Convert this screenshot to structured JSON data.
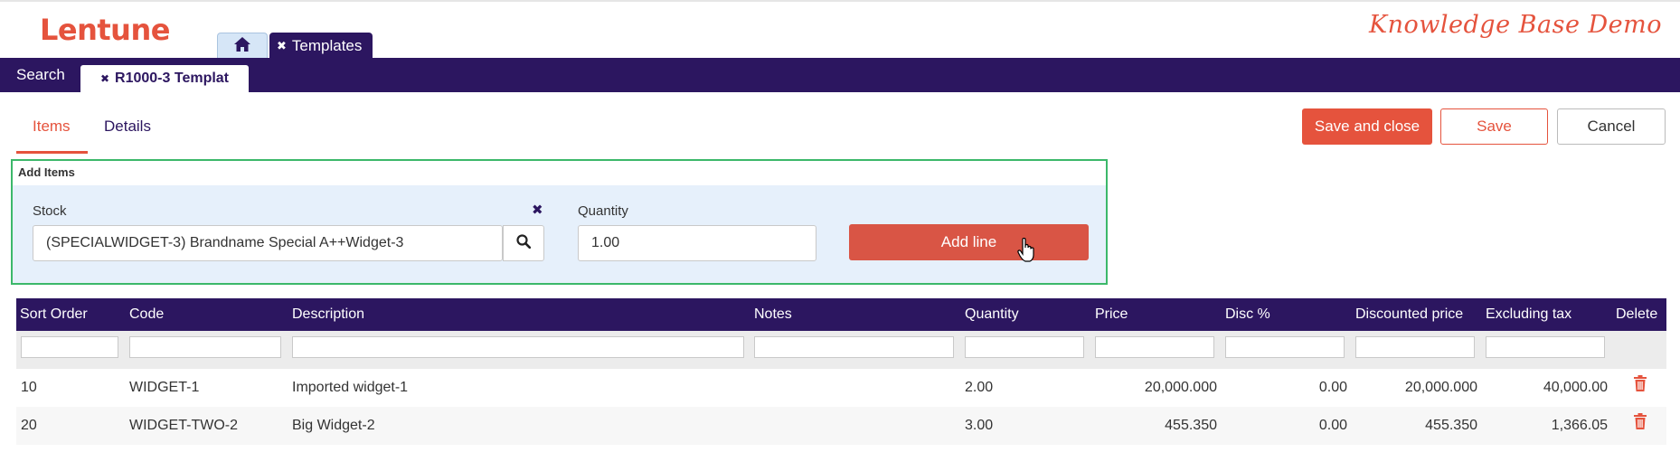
{
  "header": {
    "logo": "Lentune",
    "brand": "Knowledge Base Demo",
    "tabs": [
      {
        "label": "Templates",
        "close_glyph": "✖"
      }
    ]
  },
  "nav": {
    "search_label": "Search",
    "doc_tab_label": "R1000-3 Templat",
    "doc_tab_close_glyph": "✖"
  },
  "subtabs": {
    "items_label": "Items",
    "details_label": "Details"
  },
  "actions": {
    "save_close_label": "Save and close",
    "save_label": "Save",
    "cancel_label": "Cancel"
  },
  "add_items": {
    "title": "Add Items",
    "stock_label": "Stock",
    "stock_value": "(SPECIALWIDGET-3) Brandname Special A++Widget-3",
    "clear_glyph": "✖",
    "quantity_label": "Quantity",
    "quantity_value": "1.00",
    "add_line_label": "Add line"
  },
  "table": {
    "columns": [
      "Sort Order",
      "Code",
      "Description",
      "Notes",
      "Quantity",
      "Price",
      "Disc %",
      "Discounted price",
      "Excluding tax",
      "Delete"
    ],
    "rows": [
      {
        "sort": "10",
        "code": "WIDGET-1",
        "description": "Imported widget-1",
        "notes": "",
        "quantity": "2.00",
        "price": "20,000.000",
        "disc": "0.00",
        "discounted": "20,000.000",
        "excl": "40,000.00"
      },
      {
        "sort": "20",
        "code": "WIDGET-TWO-2",
        "description": "Big Widget-2",
        "notes": "",
        "quantity": "3.00",
        "price": "455.350",
        "disc": "0.00",
        "discounted": "455.350",
        "excl": "1,366.05"
      }
    ]
  },
  "colors": {
    "accent": "#e5533d",
    "primary": "#2c1660",
    "panel_border": "#3cb86a",
    "panel_bg": "#e6f0fb"
  },
  "icons": [
    "home-icon",
    "close-icon",
    "search-icon",
    "trash-icon",
    "hand-cursor-icon"
  ]
}
